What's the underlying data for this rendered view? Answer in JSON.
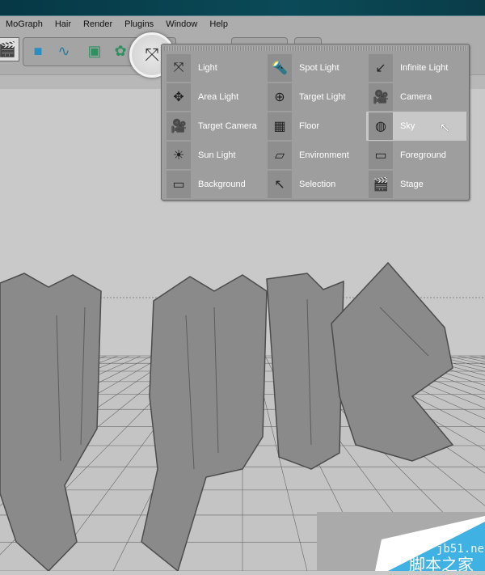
{
  "menu": [
    "MoGraph",
    "Hair",
    "Render",
    "Plugins",
    "Window",
    "Help"
  ],
  "popup": {
    "items": [
      {
        "label": "Light",
        "icon": "light-icon"
      },
      {
        "label": "Spot Light",
        "icon": "spot-light-icon"
      },
      {
        "label": "Infinite Light",
        "icon": "infinite-light-icon"
      },
      {
        "label": "Area Light",
        "icon": "area-light-icon"
      },
      {
        "label": "Target Light",
        "icon": "target-light-icon"
      },
      {
        "label": "Camera",
        "icon": "camera-icon"
      },
      {
        "label": "Target Camera",
        "icon": "target-camera-icon"
      },
      {
        "label": "Floor",
        "icon": "floor-icon"
      },
      {
        "label": "Sky",
        "icon": "sky-icon",
        "selected": true
      },
      {
        "label": "Sun Light",
        "icon": "sun-light-icon"
      },
      {
        "label": "Environment",
        "icon": "environment-icon"
      },
      {
        "label": "Foreground",
        "icon": "foreground-icon"
      },
      {
        "label": "Background",
        "icon": "background-icon"
      },
      {
        "label": "Selection",
        "icon": "selection-icon"
      },
      {
        "label": "Stage",
        "icon": "stage-icon"
      }
    ]
  },
  "watermark": {
    "site": "jb51.net",
    "name": "脚本之家"
  },
  "colors": {
    "accent": "#3fb1e3",
    "titlebar": "#063845"
  }
}
